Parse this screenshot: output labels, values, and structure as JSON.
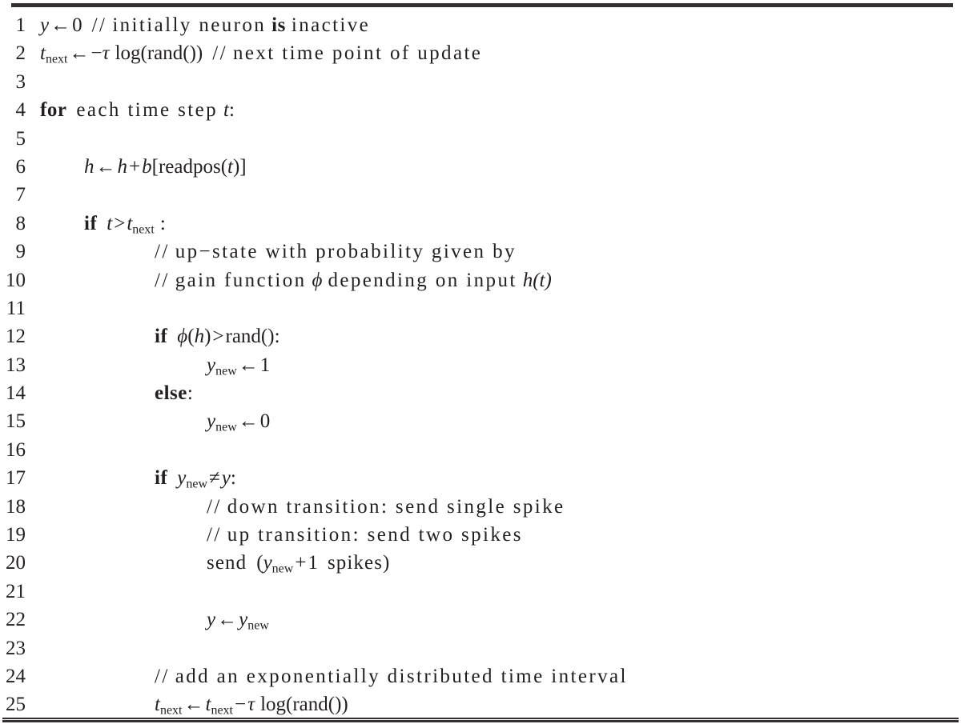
{
  "figure": {
    "kind": "algorithm-pseudocode-listing",
    "total_lines": 25,
    "rules": {
      "top": "thick",
      "bottom": "double"
    }
  },
  "lines": [
    {
      "n": "1",
      "indent": 0,
      "text": "y ← 0  // initially neuron is inactive"
    },
    {
      "n": "2",
      "indent": 0,
      "text": "t_next ← −τ log(rand())  // next time point of update"
    },
    {
      "n": "3",
      "indent": 0,
      "text": ""
    },
    {
      "n": "4",
      "indent": 0,
      "text": "for each time step t:"
    },
    {
      "n": "5",
      "indent": 0,
      "text": ""
    },
    {
      "n": "6",
      "indent": 1,
      "text": "h ← h + b[readpos(t)]"
    },
    {
      "n": "7",
      "indent": 1,
      "text": ""
    },
    {
      "n": "8",
      "indent": 1,
      "text": "if t > t_next :"
    },
    {
      "n": "9",
      "indent": 2,
      "text": "// up−state with probability given by"
    },
    {
      "n": "10",
      "indent": 2,
      "text": "// gain function ϕ depending on input h(t)"
    },
    {
      "n": "11",
      "indent": 2,
      "text": ""
    },
    {
      "n": "12",
      "indent": 2,
      "text": "if ϕ(h) > rand() :"
    },
    {
      "n": "13",
      "indent": 3,
      "text": "y_new ← 1"
    },
    {
      "n": "14",
      "indent": 2,
      "text": "else :"
    },
    {
      "n": "15",
      "indent": 3,
      "text": "y_new ← 0"
    },
    {
      "n": "16",
      "indent": 2,
      "text": ""
    },
    {
      "n": "17",
      "indent": 2,
      "text": "if y_new ≠ y:"
    },
    {
      "n": "18",
      "indent": 3,
      "text": "// down transition: send single spike"
    },
    {
      "n": "19",
      "indent": 3,
      "text": "// up transition: send two spikes"
    },
    {
      "n": "20",
      "indent": 3,
      "text": "send (y_new + 1 spikes)"
    },
    {
      "n": "21",
      "indent": 3,
      "text": ""
    },
    {
      "n": "22",
      "indent": 3,
      "text": "y ← y_new"
    },
    {
      "n": "23",
      "indent": 3,
      "text": ""
    },
    {
      "n": "24",
      "indent": 2,
      "text": "// add an exponentially distributed time interval"
    },
    {
      "n": "25",
      "indent": 2,
      "text": "t_next ← t_next − τ log(rand())"
    }
  ],
  "numbers": {
    "1": "1",
    "2": "2",
    "3": "3",
    "4": "4",
    "5": "5",
    "6": "6",
    "7": "7",
    "8": "8",
    "9": "9",
    "10": "10",
    "11": "11",
    "12": "12",
    "13": "13",
    "14": "14",
    "15": "15",
    "16": "16",
    "17": "17",
    "18": "18",
    "19": "19",
    "20": "20",
    "21": "21",
    "22": "22",
    "23": "23",
    "24": "24",
    "25": "25"
  },
  "tokens": {
    "arrow": "←",
    "minus": "−",
    "tau": "τ",
    "phi": "ϕ",
    "gt": ">",
    "neq": "≠",
    "plus": "+",
    "colon": ":",
    "slashslash": "//",
    "kw_for": "for",
    "kw_if": "if",
    "kw_else": "else",
    "kw_is": "is",
    "zero": "0",
    "one": "1",
    "y": "y",
    "h": "h",
    "t": "t",
    "b": "b",
    "sub_next": "next",
    "sub_new": "new",
    "log": "log",
    "rand": "rand()",
    "readpos": "readpos",
    "send": "send",
    "cmt_l1": "initially neuron",
    "cmt_l1b": "inactive",
    "cmt_l2": "next time point of update",
    "cmt_l9": "up−state with probability given by",
    "cmt_l10a": "gain function",
    "cmt_l10b": "depending on input",
    "cmt_l18": "down transition: send single spike",
    "cmt_l19": "up transition: send two spikes",
    "cmt_l24": "add an exponentially distributed time interval",
    "each_time_step": "each time step",
    "spikes": "spikes",
    "paren_open": "(",
    "paren_close": ")",
    "bracket_open": "[",
    "bracket_close": "]"
  },
  "colors": {
    "ink": "#231f20",
    "rule": "#332f30",
    "background": "#ffffff"
  }
}
